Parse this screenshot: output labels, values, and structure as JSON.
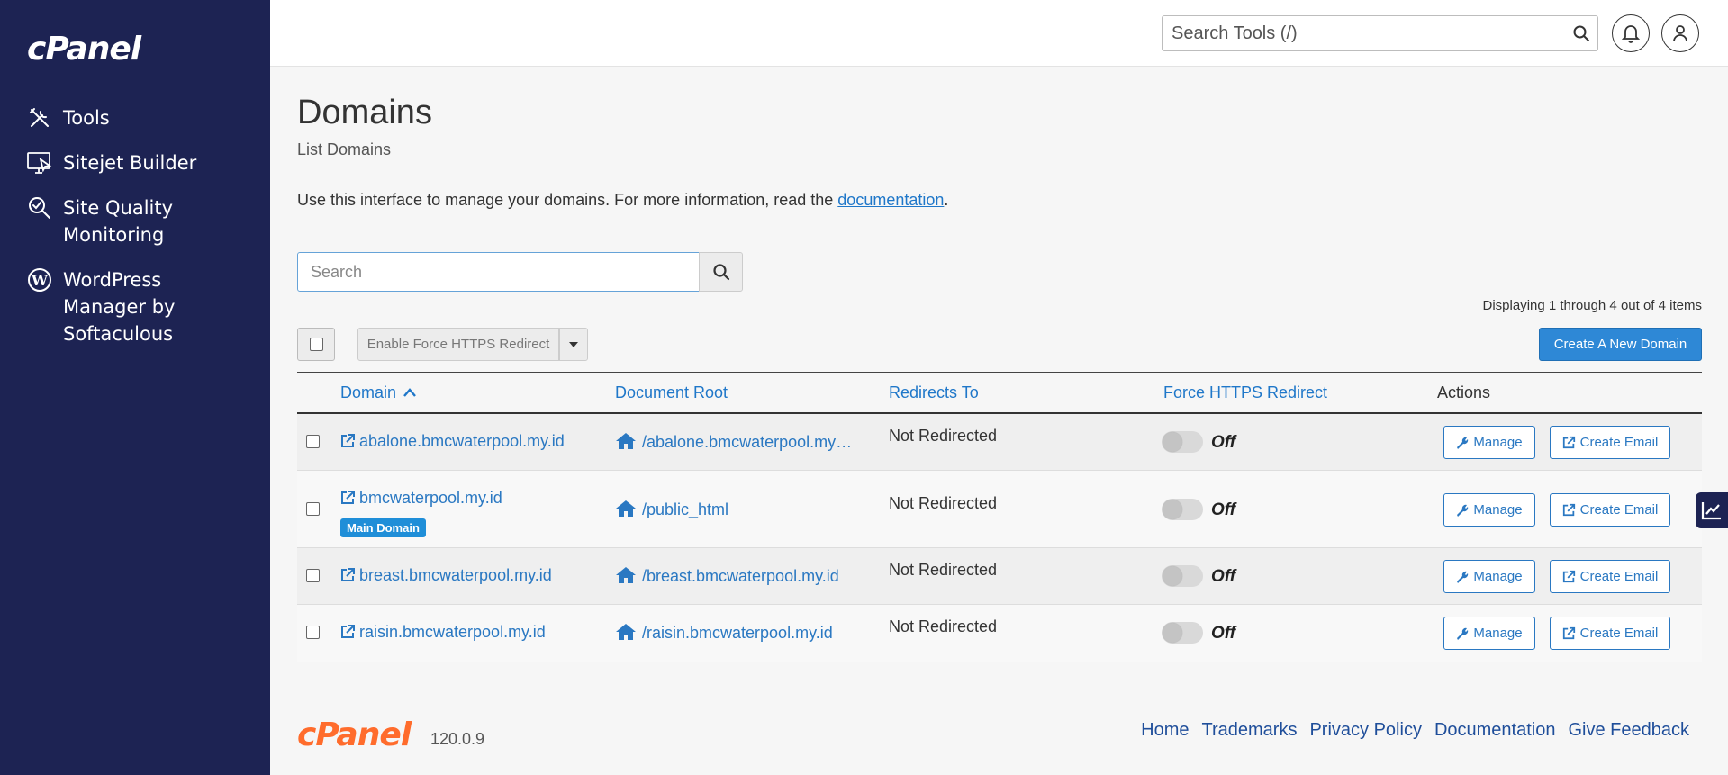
{
  "sidebar": {
    "logo": "cPanel",
    "items": [
      {
        "label": "Tools",
        "icon": "tools-icon"
      },
      {
        "label": "Sitejet Builder",
        "icon": "sitejet-icon"
      },
      {
        "label": "Site Quality Monitoring",
        "icon": "site-quality-icon"
      },
      {
        "label": "WordPress Manager by Softaculous",
        "icon": "wordpress-icon"
      }
    ]
  },
  "header": {
    "search_placeholder": "Search Tools (/)"
  },
  "page": {
    "title": "Domains",
    "subtitle": "List Domains",
    "intro_text": "Use this interface to manage your domains. For more information, read the ",
    "intro_link": "documentation",
    "intro_end": ".",
    "search_placeholder": "Search",
    "display_count": "Displaying 1 through 4 out of 4 items",
    "force_https_button": "Enable Force HTTPS Redirect",
    "create_domain_button": "Create A New Domain"
  },
  "table": {
    "headers": {
      "domain": "Domain",
      "document_root": "Document Root",
      "redirects_to": "Redirects To",
      "force_https": "Force HTTPS Redirect",
      "actions": "Actions"
    },
    "rows": [
      {
        "domain": "abalone.bmcwaterpool.my.id",
        "docroot": "/abalone.bmcwaterpool.my…",
        "redirect": "Not Redirected",
        "https": "Off",
        "manage": "Manage",
        "email": "Create Email"
      },
      {
        "domain": "bmcwaterpool.my.id",
        "badge": "Main Domain",
        "docroot": "/public_html",
        "redirect": "Not Redirected",
        "https": "Off",
        "manage": "Manage",
        "email": "Create Email"
      },
      {
        "domain": "breast.bmcwaterpool.my.id",
        "docroot": "/breast.bmcwaterpool.my.id",
        "redirect": "Not Redirected",
        "https": "Off",
        "manage": "Manage",
        "email": "Create Email"
      },
      {
        "domain": "raisin.bmcwaterpool.my.id",
        "docroot": "/raisin.bmcwaterpool.my.id",
        "redirect": "Not Redirected",
        "https": "Off",
        "manage": "Manage",
        "email": "Create Email"
      }
    ]
  },
  "footer": {
    "logo": "cPanel",
    "version": "120.0.9",
    "links": [
      "Home",
      "Trademarks",
      "Privacy Policy",
      "Documentation",
      "Give Feedback"
    ]
  },
  "colors": {
    "sidebar_bg": "#1d2353",
    "link": "#2a78c2",
    "primary_button": "#2e88d6",
    "footer_logo": "#ff6c2c"
  }
}
